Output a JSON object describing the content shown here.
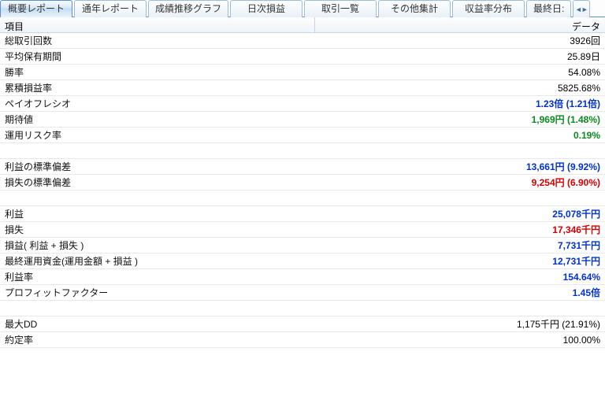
{
  "tabs": [
    {
      "label": "概要レポート",
      "active": true
    },
    {
      "label": "通年レポート",
      "active": false
    },
    {
      "label": "成績推移グラフ",
      "active": false
    },
    {
      "label": "日次損益",
      "active": false
    },
    {
      "label": "取引一覧",
      "active": false
    },
    {
      "label": "その他集計",
      "active": false
    },
    {
      "label": "収益率分布",
      "active": false
    },
    {
      "label": "最終日:",
      "active": false
    }
  ],
  "header": {
    "item": "項目",
    "data": "データ"
  },
  "rows": [
    {
      "label": "総取引回数",
      "value": "3926回",
      "color": "black"
    },
    {
      "label": "平均保有期間",
      "value": "25.89日",
      "color": "black"
    },
    {
      "label": "勝率",
      "value": "54.08%",
      "color": "black"
    },
    {
      "label": "累積損益率",
      "value": "5825.68%",
      "color": "black"
    },
    {
      "label": "ペイオフレシオ",
      "value": "1.23倍 (1.21倍)",
      "color": "blue"
    },
    {
      "label": "期待値",
      "value": "1,969円 (1.48%)",
      "color": "green"
    },
    {
      "label": "運用リスク率",
      "value": "0.19%",
      "color": "green"
    },
    {
      "label": "",
      "value": "",
      "color": "black",
      "blank": true
    },
    {
      "label": "利益の標準偏差",
      "value": "13,661円 (9.92%)",
      "color": "blue"
    },
    {
      "label": "損失の標準偏差",
      "value": "9,254円 (6.90%)",
      "color": "red"
    },
    {
      "label": "",
      "value": "",
      "color": "black",
      "blank": true
    },
    {
      "label": "利益",
      "value": "25,078千円",
      "color": "blue"
    },
    {
      "label": "損失",
      "value": "17,346千円",
      "color": "red"
    },
    {
      "label": "損益( 利益 + 損失 )",
      "value": "7,731千円",
      "color": "blue"
    },
    {
      "label": "最終運用資金(運用金額 + 損益 )",
      "value": "12,731千円",
      "color": "blue"
    },
    {
      "label": "利益率",
      "value": "154.64%",
      "color": "blue"
    },
    {
      "label": "プロフィットファクター",
      "value": "1.45倍",
      "color": "blue"
    },
    {
      "label": "",
      "value": "",
      "color": "black",
      "blank": true
    },
    {
      "label": "最大DD",
      "value": "1,175千円 (21.91%)",
      "color": "black"
    },
    {
      "label": "約定率",
      "value": "100.00%",
      "color": "black"
    }
  ]
}
